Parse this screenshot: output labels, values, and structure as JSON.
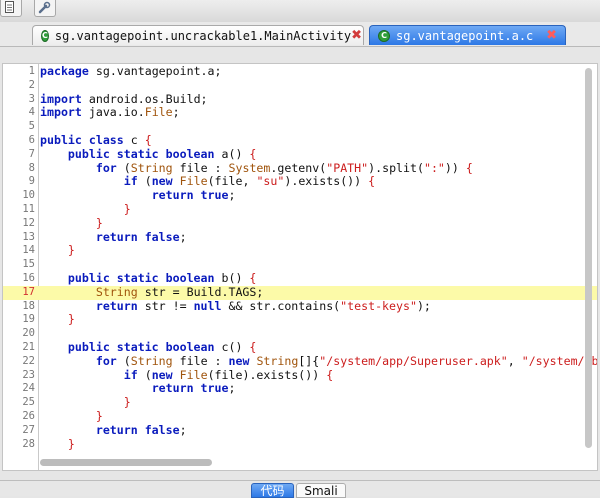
{
  "tabs": [
    {
      "label": "sg.vantagepoint.uncrackable1.MainActivity",
      "active": false
    },
    {
      "label": "sg.vantagepoint.a.c",
      "active": true
    }
  ],
  "tab_icon_glyph": "C",
  "close_glyph": "✖",
  "highlighted_line": 17,
  "code_lines": [
    [
      {
        "t": "package",
        "c": "kw"
      },
      {
        "t": " sg.vantagepoint.a;"
      }
    ],
    [],
    [
      {
        "t": "import",
        "c": "kw"
      },
      {
        "t": " android.os.Build;"
      }
    ],
    [
      {
        "t": "import",
        "c": "kw"
      },
      {
        "t": " java.io."
      },
      {
        "t": "File",
        "c": "ty"
      },
      {
        "t": ";"
      }
    ],
    [],
    [
      {
        "t": "public class",
        "c": "kw"
      },
      {
        "t": " c "
      },
      {
        "t": "{",
        "c": "br"
      }
    ],
    [
      {
        "t": "    "
      },
      {
        "t": "public static boolean",
        "c": "kw"
      },
      {
        "t": " a() "
      },
      {
        "t": "{",
        "c": "br"
      }
    ],
    [
      {
        "t": "        "
      },
      {
        "t": "for",
        "c": "kw"
      },
      {
        "t": " ("
      },
      {
        "t": "String",
        "c": "ty"
      },
      {
        "t": " file : "
      },
      {
        "t": "System",
        "c": "ty"
      },
      {
        "t": ".getenv("
      },
      {
        "t": "\"PATH\"",
        "c": "st"
      },
      {
        "t": ").split("
      },
      {
        "t": "\":\"",
        "c": "st"
      },
      {
        "t": ")) "
      },
      {
        "t": "{",
        "c": "br"
      }
    ],
    [
      {
        "t": "            "
      },
      {
        "t": "if",
        "c": "kw"
      },
      {
        "t": " ("
      },
      {
        "t": "new",
        "c": "kw"
      },
      {
        "t": " "
      },
      {
        "t": "File",
        "c": "ty"
      },
      {
        "t": "(file, "
      },
      {
        "t": "\"su\"",
        "c": "st"
      },
      {
        "t": ").exists()) "
      },
      {
        "t": "{",
        "c": "br"
      }
    ],
    [
      {
        "t": "                "
      },
      {
        "t": "return true",
        "c": "kw"
      },
      {
        "t": ";"
      }
    ],
    [
      {
        "t": "            "
      },
      {
        "t": "}",
        "c": "br"
      }
    ],
    [
      {
        "t": "        "
      },
      {
        "t": "}",
        "c": "br"
      }
    ],
    [
      {
        "t": "        "
      },
      {
        "t": "return false",
        "c": "kw"
      },
      {
        "t": ";"
      }
    ],
    [
      {
        "t": "    "
      },
      {
        "t": "}",
        "c": "br"
      }
    ],
    [],
    [
      {
        "t": "    "
      },
      {
        "t": "public static boolean",
        "c": "kw"
      },
      {
        "t": " b() "
      },
      {
        "t": "{",
        "c": "br"
      }
    ],
    [
      {
        "t": "        "
      },
      {
        "t": "String",
        "c": "ty"
      },
      {
        "t": " str = Build.TAGS;"
      }
    ],
    [
      {
        "t": "        "
      },
      {
        "t": "return",
        "c": "kw"
      },
      {
        "t": " str != "
      },
      {
        "t": "null",
        "c": "kw"
      },
      {
        "t": " && str.contains("
      },
      {
        "t": "\"test-keys\"",
        "c": "st"
      },
      {
        "t": ");"
      }
    ],
    [
      {
        "t": "    "
      },
      {
        "t": "}",
        "c": "br"
      }
    ],
    [],
    [
      {
        "t": "    "
      },
      {
        "t": "public static boolean",
        "c": "kw"
      },
      {
        "t": " c() "
      },
      {
        "t": "{",
        "c": "br"
      }
    ],
    [
      {
        "t": "        "
      },
      {
        "t": "for",
        "c": "kw"
      },
      {
        "t": " ("
      },
      {
        "t": "String",
        "c": "ty"
      },
      {
        "t": " file : "
      },
      {
        "t": "new",
        "c": "kw"
      },
      {
        "t": " "
      },
      {
        "t": "String",
        "c": "ty"
      },
      {
        "t": "[]{"
      },
      {
        "t": "\"/system/app/Superuser.apk\"",
        "c": "st"
      },
      {
        "t": ", "
      },
      {
        "t": "\"/system/xbin/",
        "c": "st"
      }
    ],
    [
      {
        "t": "            "
      },
      {
        "t": "if",
        "c": "kw"
      },
      {
        "t": " ("
      },
      {
        "t": "new",
        "c": "kw"
      },
      {
        "t": " "
      },
      {
        "t": "File",
        "c": "ty"
      },
      {
        "t": "(file).exists()) "
      },
      {
        "t": "{",
        "c": "br"
      }
    ],
    [
      {
        "t": "                "
      },
      {
        "t": "return true",
        "c": "kw"
      },
      {
        "t": ";"
      }
    ],
    [
      {
        "t": "            "
      },
      {
        "t": "}",
        "c": "br"
      }
    ],
    [
      {
        "t": "        "
      },
      {
        "t": "}",
        "c": "br"
      }
    ],
    [
      {
        "t": "        "
      },
      {
        "t": "return false",
        "c": "kw"
      },
      {
        "t": ";"
      }
    ],
    [
      {
        "t": "    "
      },
      {
        "t": "}",
        "c": "br"
      }
    ]
  ],
  "bottom_tabs": [
    {
      "label": "代码",
      "active": true
    },
    {
      "label": "Smali",
      "active": false
    }
  ]
}
